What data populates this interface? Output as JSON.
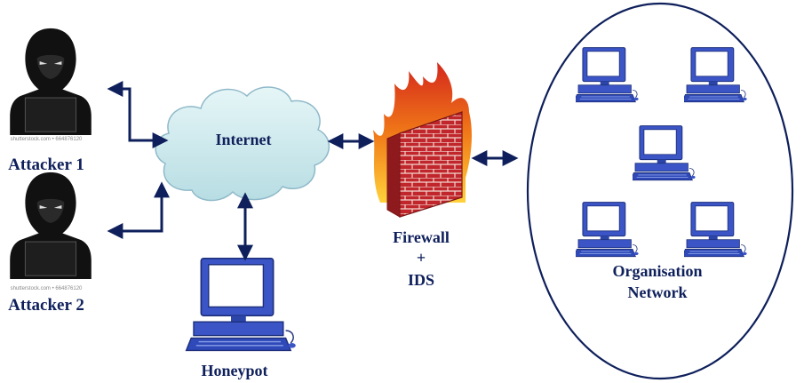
{
  "labels": {
    "attacker1": "Attacker 1",
    "attacker2": "Attacker 2",
    "internet": "Internet",
    "honeypot": "Honeypot",
    "firewall_line1": "Firewall",
    "firewall_line2": "+",
    "firewall_line3": "IDS",
    "org_line1": "Organisation",
    "org_line2": "Network"
  },
  "watermarks": {
    "attacker1": "shutterstock.com • 664876120",
    "attacker2": "shutterstock.com • 664876120"
  },
  "colors": {
    "arrow": "#0e1f5b",
    "label": "#0e1f5b",
    "cloud": "#cfe9ec",
    "cloud_stroke": "#8fb9c9",
    "monitor_body": "#3b55c7",
    "monitor_screen": "#ffffff",
    "brick": "#c0262b",
    "flame": "#f07818"
  }
}
